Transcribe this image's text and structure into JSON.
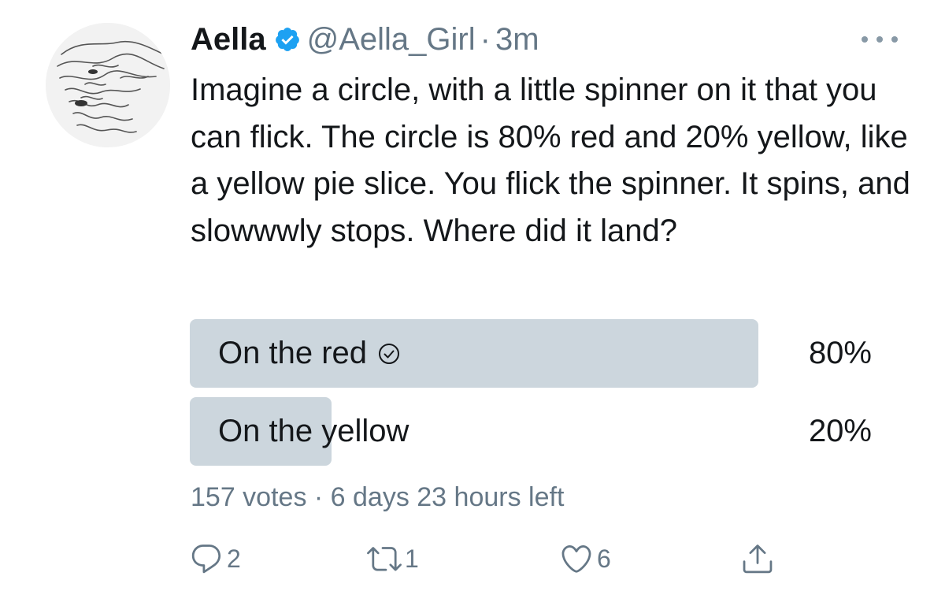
{
  "author": {
    "name": "Aella",
    "handle": "@Aella_Girl",
    "separator": "·",
    "time": "3m"
  },
  "tweet": {
    "text": "Imagine a circle, with a little spinner on it that you can flick. The circle is 80% red and 20% yellow, like a yellow pie slice. You flick the spinner. It spins, and slowwwly stops. Where did it land?"
  },
  "poll": {
    "options": [
      {
        "label": "On the red",
        "percent_label": "80%",
        "share": 0.8,
        "selected": true
      },
      {
        "label": "On the yellow",
        "percent_label": "20%",
        "share": 0.2,
        "selected": false
      }
    ],
    "meta": "157 votes · 6 days 23 hours left"
  },
  "actions": {
    "reply_count": "2",
    "retweet_count": "1",
    "like_count": "6"
  },
  "colors": {
    "verified": "#1da1f2",
    "poll_fill": "#ccd6dd",
    "secondary_text": "#657786"
  },
  "icons": {
    "verified": "verified-badge-icon",
    "more": "more-dots-icon",
    "reply": "reply-icon",
    "retweet": "retweet-icon",
    "like": "heart-icon",
    "share": "share-icon",
    "selected_choice": "check-circle-icon"
  }
}
